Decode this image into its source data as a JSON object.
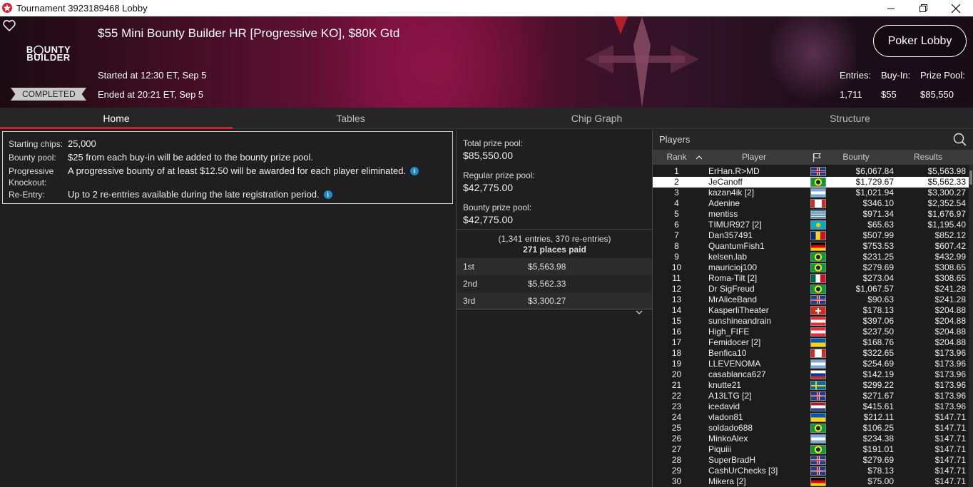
{
  "window": {
    "title": "Tournament 3923189468 Lobby"
  },
  "header": {
    "logo_line1": "B◯UNTY",
    "logo_line2": "BUILDER",
    "name": "$55 Mini Bounty Builder HR [Progressive KO], $80K Gtd",
    "started": "Started at 12:30 ET, Sep 5",
    "ended": "Ended at 20:21 ET, Sep 5",
    "status": "COMPLETED",
    "lobby_button": "Poker Lobby",
    "entries_label": "Entries:",
    "entries": "1,711",
    "buyin_label": "Buy-In:",
    "buyin": "$55",
    "prize_label": "Prize Pool:",
    "prize": "$85,550"
  },
  "tabs": [
    "Home",
    "Tables",
    "Chip Graph",
    "Structure"
  ],
  "info": {
    "starting_chips_label": "Starting chips:",
    "starting_chips": "25,000",
    "bounty_pool_label": "Bounty pool:",
    "bounty_pool": "$25 from each buy-in will be added to the bounty prize pool.",
    "progressive_label1": "Progressive",
    "progressive_label2": "Knockout:",
    "progressive": "A progressive bounty of at least $12.50 will be awarded for each player eliminated.",
    "reentry_label": "Re-Entry:",
    "reentry": "Up to 2 re-entries available during the late registration period."
  },
  "prizes": {
    "total_label": "Total prize pool:",
    "total": "$85,550.00",
    "regular_label": "Regular prize pool:",
    "regular": "$42,775.00",
    "bounty_label": "Bounty prize pool:",
    "bounty": "$42,775.00",
    "entries_line": "(1,341 entries, 370 re-entries)",
    "places_line": "271 places paid",
    "payouts": [
      {
        "place": "1st",
        "amount": "$5,563.98"
      },
      {
        "place": "2nd",
        "amount": "$5,562.33"
      },
      {
        "place": "3rd",
        "amount": "$3,300.27"
      }
    ]
  },
  "players": {
    "title": "Players",
    "columns": {
      "rank": "Rank",
      "player": "Player",
      "bounty": "Bounty",
      "results": "Results"
    },
    "rows": [
      {
        "rank": "1",
        "name": "ErHan.R>MD",
        "flag": "uk",
        "bounty": "$6,067.84",
        "result": "$5,563.98"
      },
      {
        "rank": "2",
        "name": "JeCanoff",
        "flag": "br",
        "bounty": "$1,729.67",
        "result": "$5,562.33"
      },
      {
        "rank": "3",
        "name": "kazan4ik [2]",
        "flag": "ar",
        "bounty": "$1,021.94",
        "result": "$3,300.27"
      },
      {
        "rank": "4",
        "name": "Adenine",
        "flag": "ca",
        "bounty": "$346.10",
        "result": "$2,352.54"
      },
      {
        "rank": "5",
        "name": "mentiss",
        "flag": "gr",
        "bounty": "$971.34",
        "result": "$1,676.97"
      },
      {
        "rank": "6",
        "name": "TIMUR927 [2]",
        "flag": "kz",
        "bounty": "$65.63",
        "result": "$1,195.40"
      },
      {
        "rank": "7",
        "name": "Dan357491",
        "flag": "ro",
        "bounty": "$507.99",
        "result": "$852.12"
      },
      {
        "rank": "8",
        "name": "QuantumFish1",
        "flag": "de",
        "bounty": "$753.53",
        "result": "$607.42"
      },
      {
        "rank": "9",
        "name": "kelsen.lab",
        "flag": "br",
        "bounty": "$231.25",
        "result": "$432.99"
      },
      {
        "rank": "10",
        "name": "mauricioj100",
        "flag": "br",
        "bounty": "$279.69",
        "result": "$308.65"
      },
      {
        "rank": "11",
        "name": "Roma-Tilt [2]",
        "flag": "mx",
        "bounty": "$273.04",
        "result": "$308.65"
      },
      {
        "rank": "12",
        "name": "Dr SigFreud",
        "flag": "br",
        "bounty": "$1,067.57",
        "result": "$241.28"
      },
      {
        "rank": "13",
        "name": "MrAliceBand",
        "flag": "uk",
        "bounty": "$90.63",
        "result": "$241.28"
      },
      {
        "rank": "14",
        "name": "KasperliTheater",
        "flag": "ch",
        "bounty": "$178.13",
        "result": "$204.88"
      },
      {
        "rank": "15",
        "name": "sunshineandrain",
        "flag": "at",
        "bounty": "$397.06",
        "result": "$204.88"
      },
      {
        "rank": "16",
        "name": "High_FIFE",
        "flag": "at",
        "bounty": "$237.50",
        "result": "$204.88"
      },
      {
        "rank": "17",
        "name": "Femidocer [2]",
        "flag": "ua",
        "bounty": "$168.76",
        "result": "$204.88"
      },
      {
        "rank": "18",
        "name": "Benfica10",
        "flag": "ca",
        "bounty": "$322.65",
        "result": "$173.96"
      },
      {
        "rank": "19",
        "name": "LLEVENOMA",
        "flag": "ar",
        "bounty": "$254.69",
        "result": "$173.96"
      },
      {
        "rank": "20",
        "name": "casablanca627",
        "flag": "ru",
        "bounty": "$142.19",
        "result": "$173.96"
      },
      {
        "rank": "21",
        "name": "knutte21",
        "flag": "se",
        "bounty": "$299.22",
        "result": "$173.96"
      },
      {
        "rank": "22",
        "name": "A13LTG [2]",
        "flag": "uk",
        "bounty": "$271.67",
        "result": "$173.96"
      },
      {
        "rank": "23",
        "name": "icedavid",
        "flag": "nl",
        "bounty": "$415.61",
        "result": "$173.96"
      },
      {
        "rank": "24",
        "name": "vladon81",
        "flag": "ua",
        "bounty": "$212.11",
        "result": "$147.71"
      },
      {
        "rank": "25",
        "name": "soldado688",
        "flag": "br",
        "bounty": "$106.25",
        "result": "$147.71"
      },
      {
        "rank": "26",
        "name": "MinkoAlex",
        "flag": "ar",
        "bounty": "$234.38",
        "result": "$147.71"
      },
      {
        "rank": "27",
        "name": "Piquiii",
        "flag": "br",
        "bounty": "$191.01",
        "result": "$147.71"
      },
      {
        "rank": "28",
        "name": "SuperBradH",
        "flag": "uk",
        "bounty": "$279.69",
        "result": "$147.71"
      },
      {
        "rank": "29",
        "name": "CashUrChecks [3]",
        "flag": "uk",
        "bounty": "$78.13",
        "result": "$147.71"
      },
      {
        "rank": "30",
        "name": "Mikera [2]",
        "flag": "de",
        "bounty": "$75.00",
        "result": "$147.71"
      }
    ]
  }
}
